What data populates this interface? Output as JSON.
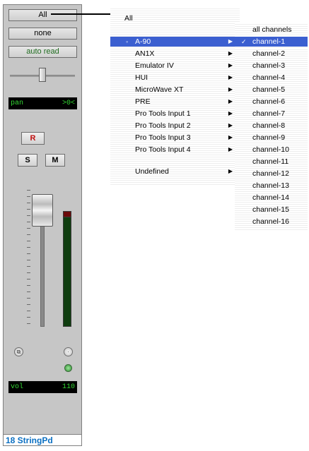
{
  "strip": {
    "input_label": "All",
    "output_label": "none",
    "automation_label": "auto read",
    "pan_label": "pan",
    "pan_value": ">0<",
    "record_label": "R",
    "solo_label": "S",
    "mute_label": "M",
    "volume_label": "vol",
    "volume_value": "110",
    "track_name": "18 StringPd",
    "pan_position": 0.5
  },
  "menu": {
    "top_label": "All",
    "devices": [
      {
        "label": "A-90",
        "has_submenu": true,
        "selected": true,
        "highlighted": true
      },
      {
        "label": "AN1X",
        "has_submenu": true
      },
      {
        "label": "Emulator IV",
        "has_submenu": true
      },
      {
        "label": "HUI",
        "has_submenu": true
      },
      {
        "label": "MicroWave XT",
        "has_submenu": true
      },
      {
        "label": "PRE",
        "has_submenu": true
      },
      {
        "label": "Pro Tools Input 1",
        "has_submenu": true
      },
      {
        "label": "Pro Tools Input 2",
        "has_submenu": true
      },
      {
        "label": "Pro Tools Input 3",
        "has_submenu": true
      },
      {
        "label": "Pro Tools Input 4",
        "has_submenu": true
      }
    ],
    "undefined_label": "Undefined"
  },
  "submenu": {
    "items": [
      {
        "label": "all channels",
        "checked": false
      },
      {
        "label": "channel-1",
        "checked": true,
        "highlighted": true
      },
      {
        "label": "channel-2"
      },
      {
        "label": "channel-3"
      },
      {
        "label": "channel-4"
      },
      {
        "label": "channel-5"
      },
      {
        "label": "channel-6"
      },
      {
        "label": "channel-7"
      },
      {
        "label": "channel-8"
      },
      {
        "label": "channel-9"
      },
      {
        "label": "channel-10"
      },
      {
        "label": "channel-11"
      },
      {
        "label": "channel-12"
      },
      {
        "label": "channel-13"
      },
      {
        "label": "channel-14"
      },
      {
        "label": "channel-15"
      },
      {
        "label": "channel-16"
      }
    ]
  },
  "icons": {
    "submenu_arrow": "triangle-right-icon",
    "checkmark": "checkmark-icon",
    "selected_dot": "selected-dot-icon"
  },
  "colors": {
    "highlight": "#3b5fd0",
    "lcd_text": "#33d633",
    "track_name": "#0a6fc2",
    "record": "#c01010"
  }
}
